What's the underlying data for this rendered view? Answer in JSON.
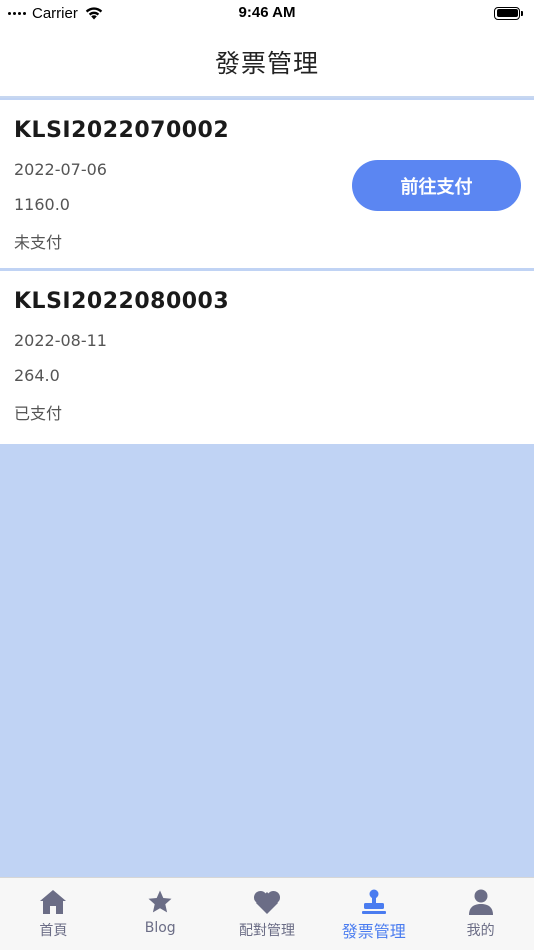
{
  "status_bar": {
    "carrier": "Carrier",
    "time": "9:46 AM"
  },
  "header": {
    "title": "發票管理"
  },
  "invoices": [
    {
      "number": "KLSI2022070002",
      "date": "2022-07-06",
      "amount": "1160.0",
      "status": "未支付",
      "action_label": "前往支付"
    },
    {
      "number": "KLSI2022080003",
      "date": "2022-08-11",
      "amount": "264.0",
      "status": "已支付"
    }
  ],
  "tab_bar": {
    "items": [
      {
        "label": "首頁",
        "icon": "home-icon"
      },
      {
        "label": "Blog",
        "icon": "star-icon"
      },
      {
        "label": "配對管理",
        "icon": "heart-icon"
      },
      {
        "label": "發票管理",
        "icon": "stamp-icon",
        "active": true
      },
      {
        "label": "我的",
        "icon": "person-icon"
      }
    ]
  },
  "colors": {
    "accent": "#5b86f2",
    "active_tab": "#4a7cf0",
    "inactive_tab": "#6b6d86",
    "background": "#c0d3f4"
  }
}
